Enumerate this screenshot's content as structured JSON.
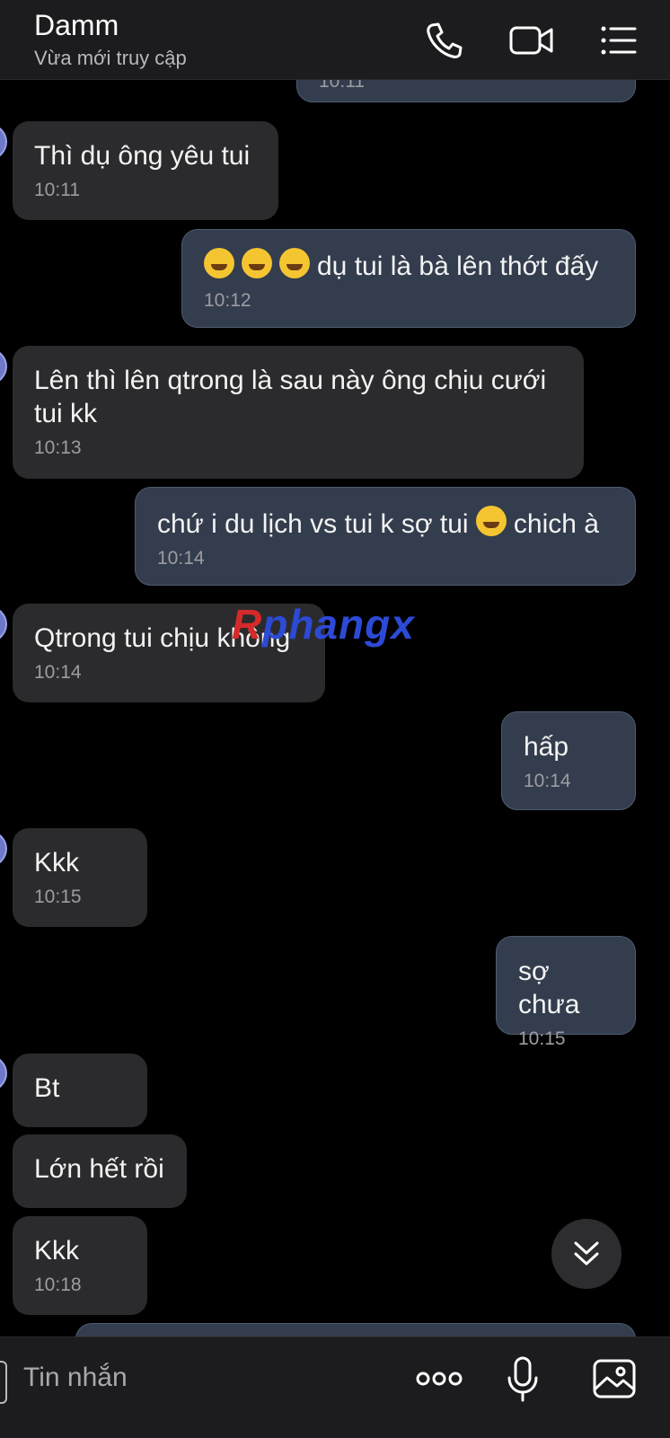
{
  "header": {
    "contact_name": "Damm",
    "status": "Vừa mới truy cập",
    "icons": [
      "phone-icon",
      "video-call-icon",
      "menu-list-icon"
    ]
  },
  "messages": [
    {
      "direction": "out",
      "text": "",
      "time": "10:11"
    },
    {
      "direction": "in",
      "text": "Thì dụ ông yêu tui",
      "time": "10:11"
    },
    {
      "direction": "out",
      "emoji_prefix": [
        "grinning-sweat-emoji",
        "grinning-sweat-emoji",
        "grinning-sweat-emoji"
      ],
      "text": "dụ tui là bà lên thớt đấy",
      "time": "10:12"
    },
    {
      "direction": "in",
      "text": "Lên thì lên qtrong là sau này ông chịu cưới tui kk",
      "time": "10:13"
    },
    {
      "direction": "out",
      "text_before": "chứ i du lịch vs tui k sợ tui",
      "emoji_inline": "relieved-face-emoji",
      "text_after": "chich à",
      "time": "10:14"
    },
    {
      "direction": "in",
      "text": "Qtrong tui chịu không",
      "time": "10:14"
    },
    {
      "direction": "out",
      "text": "hấp",
      "time": "10:14"
    },
    {
      "direction": "in",
      "text": "Kkk",
      "time": "10:15"
    },
    {
      "direction": "out",
      "text": "sợ chưa",
      "time": "10:15"
    },
    {
      "direction": "in",
      "text": "Bt",
      "time": ""
    },
    {
      "direction": "in",
      "text": "Lớn hết rồi",
      "time": ""
    },
    {
      "direction": "in",
      "text": "Kkk",
      "time": "10:18"
    }
  ],
  "watermark": {
    "part1": "R",
    "part2": "phangx"
  },
  "input": {
    "placeholder": "Tin nhắn",
    "icons": [
      "more-options-icon",
      "microphone-icon",
      "image-gallery-icon"
    ]
  },
  "colors": {
    "background": "#000000",
    "header": "#1c1c1e",
    "incoming_bubble": "#2b2b2d",
    "outgoing_bubble": "#333d4d",
    "outgoing_border": "#4d5b71"
  }
}
